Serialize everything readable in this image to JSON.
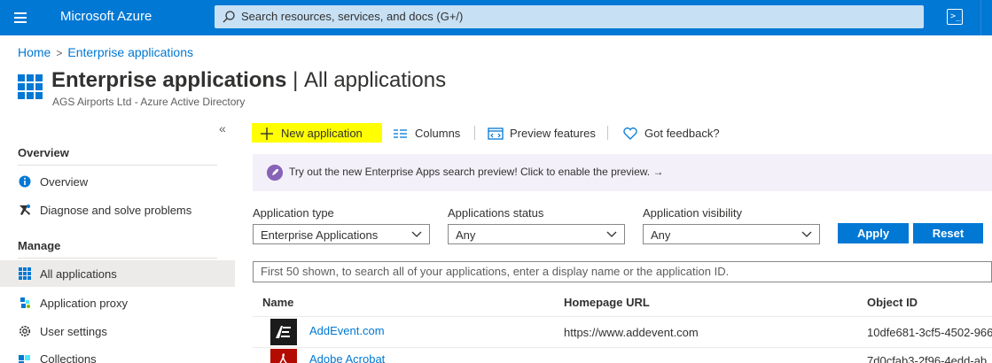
{
  "topbar": {
    "brand": "Microsoft Azure",
    "search_placeholder": "Search resources, services, and docs (G+/)",
    "accent": "#0078d4",
    "icons": [
      "hamburger-menu-icon",
      "search-icon",
      "cloud-shell-icon"
    ]
  },
  "breadcrumb": {
    "home": "Home",
    "current": "Enterprise applications"
  },
  "header": {
    "title_bold": "Enterprise applications",
    "title_sep": " | ",
    "title_rest": "All applications",
    "subtitle": "AGS Airports Ltd - Azure Active Directory"
  },
  "sidebar": {
    "collapse_glyph": "«",
    "sections": [
      {
        "title": "Overview"
      },
      {
        "title": "Manage"
      }
    ],
    "items": [
      {
        "label": "Overview",
        "icon": "info-icon"
      },
      {
        "label": "Diagnose and solve problems",
        "icon": "wrench-icon"
      },
      {
        "label": "All applications",
        "icon": "grid-icon",
        "active": true
      },
      {
        "label": "Application proxy",
        "icon": "proxy-icon"
      },
      {
        "label": "User settings",
        "icon": "gear-icon"
      },
      {
        "label": "Collections",
        "icon": "collections-icon"
      }
    ]
  },
  "commandbar": {
    "new_application": "New application",
    "columns": "Columns",
    "preview_features": "Preview features",
    "feedback": "Got feedback?"
  },
  "banner": {
    "text": "Try out the new Enterprise Apps search preview! Click to enable the preview.",
    "arrow": "→"
  },
  "filters": {
    "app_type": {
      "label": "Application type",
      "value": "Enterprise Applications"
    },
    "app_status": {
      "label": "Applications status",
      "value": "Any"
    },
    "app_visibility": {
      "label": "Application visibility",
      "value": "Any"
    },
    "apply": "Apply",
    "reset": "Reset"
  },
  "search": {
    "placeholder": "First 50 shown, to search all of your applications, enter a display name or the application ID."
  },
  "table": {
    "columns": [
      "Name",
      "Homepage URL",
      "Object ID"
    ],
    "rows": [
      {
        "name": "AddEvent.com",
        "url": "https://www.addevent.com",
        "object_id": "10dfe681-3cf5-4502-966",
        "logo": "addevent-logo-icon"
      },
      {
        "name": "Adobe Acrobat",
        "url": "",
        "object_id": "7d0cfab3-2f96-4edd-ab",
        "logo": "adobe-acrobat-logo-icon"
      }
    ]
  }
}
